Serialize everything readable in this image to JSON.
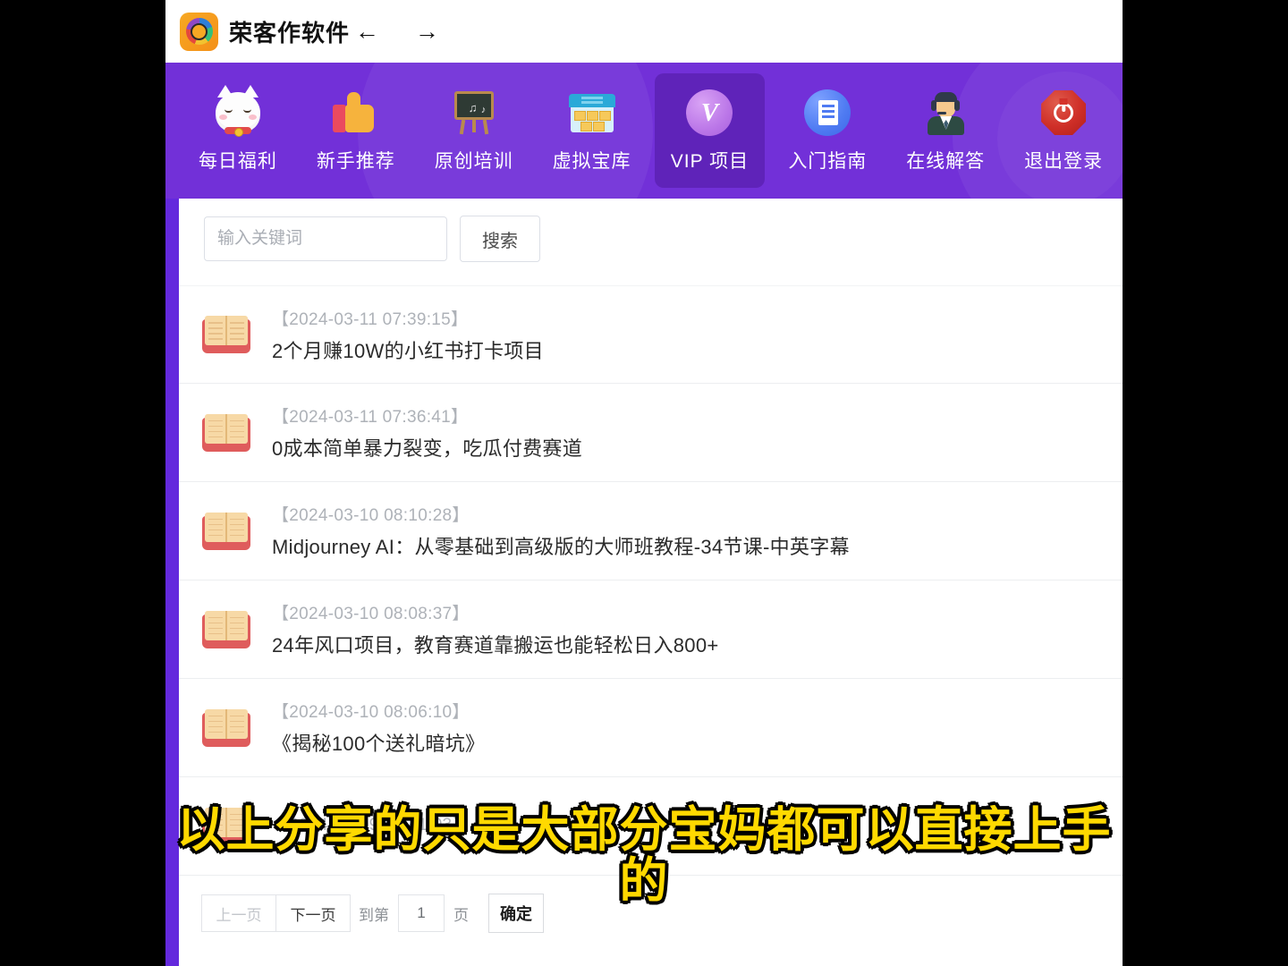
{
  "window": {
    "app_title": "荣客作软件",
    "logo_icon": "app-logo-icon",
    "back_arrow": "←",
    "forward_arrow": "→"
  },
  "navbar": {
    "items": [
      {
        "label": "每日福利",
        "icon": "lucky-cat-icon",
        "active": false
      },
      {
        "label": "新手推荐",
        "icon": "thumbs-up-icon",
        "active": false
      },
      {
        "label": "原创培训",
        "icon": "chalkboard-icon",
        "active": false
      },
      {
        "label": "虚拟宝库",
        "icon": "warehouse-icon",
        "active": false
      },
      {
        "label": "VIP 项目",
        "icon": "vip-badge-icon",
        "active": true
      },
      {
        "label": "入门指南",
        "icon": "document-icon",
        "active": false
      },
      {
        "label": "在线解答",
        "icon": "support-agent-icon",
        "active": false
      },
      {
        "label": "退出登录",
        "icon": "power-off-icon",
        "active": false
      }
    ]
  },
  "search": {
    "placeholder": "输入关键词",
    "value": "",
    "button_label": "搜索"
  },
  "list": {
    "item_icon": "open-book-icon",
    "items": [
      {
        "date": "【2024-03-11 07:39:15】",
        "title": "2个月赚10W的小红书打卡项目"
      },
      {
        "date": "【2024-03-11 07:36:41】",
        "title": "0成本简单暴力裂变，吃瓜付费赛道"
      },
      {
        "date": "【2024-03-10 08:10:28】",
        "title": "Midjourney AI：从零基础到高级版的大师班教程-34节课-中英字幕"
      },
      {
        "date": "【2024-03-10 08:08:37】",
        "title": "24年风口项目，教育赛道靠搬运也能轻松日入800+"
      },
      {
        "date": "【2024-03-10 08:06:10】",
        "title": "《揭秘100个送礼暗坑》"
      },
      {
        "date": "【2024-03-09 09:41:03】",
        "title": ""
      }
    ]
  },
  "pagination": {
    "prev_label": "上一页",
    "next_label": "下一页",
    "goto_label": "到第",
    "page_value": "1",
    "page_unit": "页",
    "confirm_label": "确定"
  },
  "subtitle": {
    "line1": "以上分享的只是大部分宝妈都可以直接上手",
    "line2": "的"
  },
  "colors": {
    "navbar_purple": "#7230d8",
    "rail_purple": "#6429dd",
    "active_tab_purple": "#5f23b9",
    "subtitle_yellow": "#ffd900"
  }
}
